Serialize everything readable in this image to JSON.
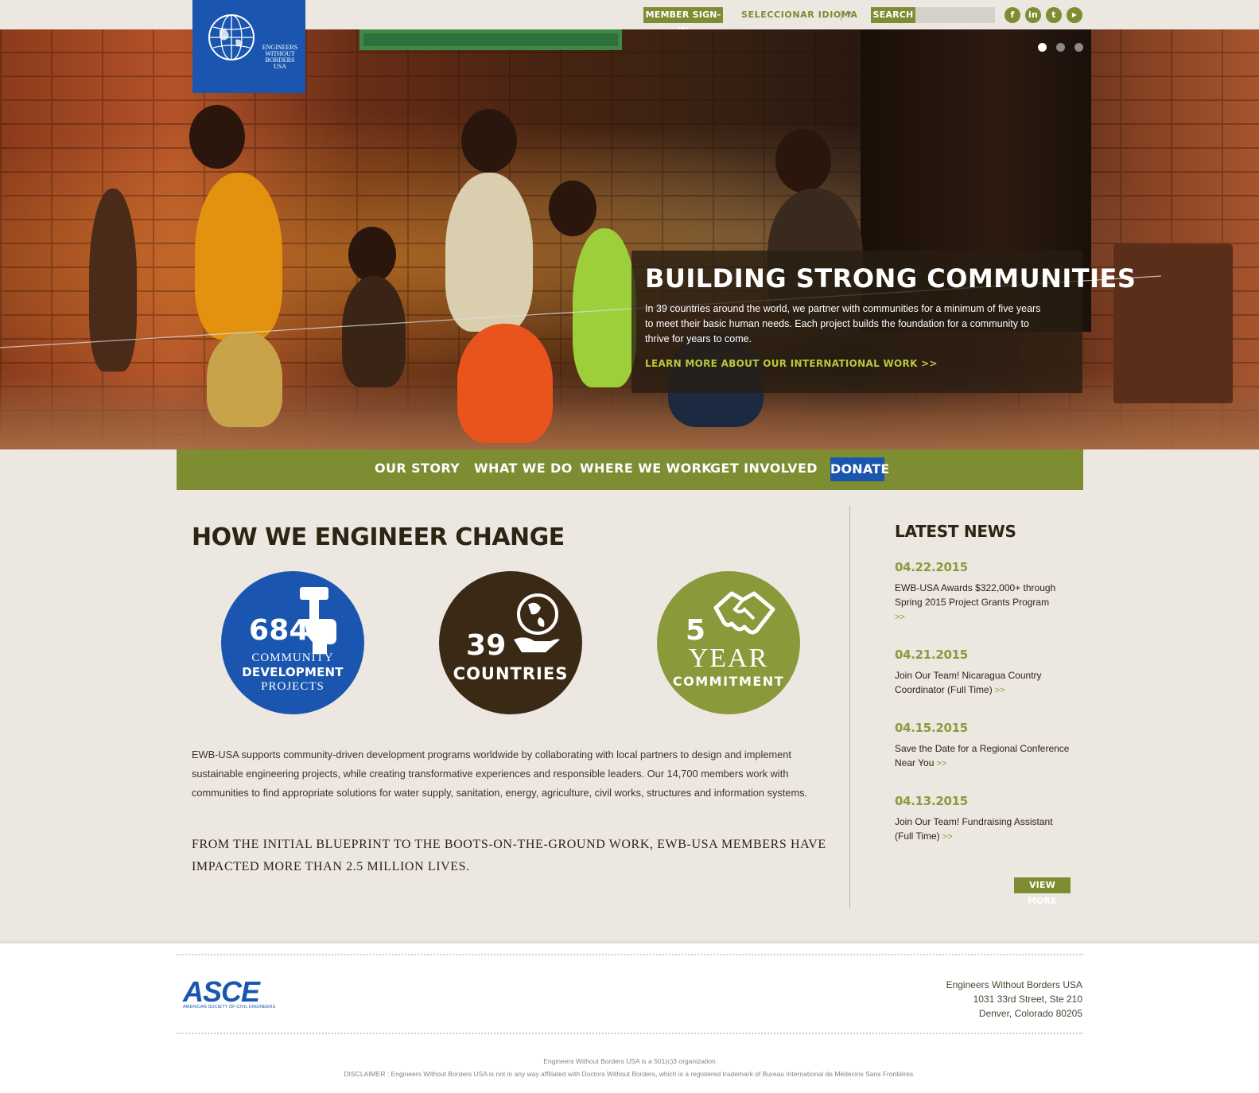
{
  "header": {
    "logo_text": "ENGINEERS\nWITHOUT\nBORDERS\nUSA",
    "member_signin": "MEMBER SIGN-IN",
    "language": "SELECCIONAR IDIOMA",
    "language_arrow": "▼",
    "search_label": "SEARCH",
    "search_value": "",
    "social": [
      {
        "icon": "facebook-icon",
        "glyph": "f"
      },
      {
        "icon": "linkedin-icon",
        "glyph": "in"
      },
      {
        "icon": "twitter-icon",
        "glyph": "t"
      },
      {
        "icon": "youtube-icon",
        "glyph": "▶"
      }
    ]
  },
  "hero": {
    "title": "BUILDING STRONG COMMUNITIES",
    "body": "In 39 countries around the world, we partner with communities for a minimum of five years to meet their basic human needs. Each project builds the foundation for a community to thrive for years to come.",
    "link": "LEARN MORE ABOUT OUR INTERNATIONAL WORK >>",
    "slides": 3,
    "active_slide": 1
  },
  "nav": {
    "items": [
      "OUR STORY",
      "WHAT WE DO",
      "WHERE WE WORK",
      "GET INVOLVED"
    ],
    "donate": "DONATE"
  },
  "main": {
    "title": "HOW WE ENGINEER CHANGE",
    "stats": [
      {
        "number": "684",
        "label_1": "COMMUNITY",
        "label_2": "DEVELOPMENT",
        "label_3": "PROJECTS",
        "color": "#1a56b0",
        "icon": "hammer-hand-icon"
      },
      {
        "number": "39",
        "label_1": "COUNTRIES",
        "color": "#3a2a15",
        "icon": "globe-hand-icon"
      },
      {
        "number": "5",
        "label_1": "YEAR",
        "label_2": "COMMITMENT",
        "color": "#8a9a3a",
        "icon": "handshake-icon"
      }
    ],
    "body": "EWB-USA supports community-driven development programs worldwide by collaborating with local partners to design and implement sustainable engineering projects, while creating transformative experiences and responsible leaders. Our 14,700 members work with communities to find appropriate solutions for water supply, sanitation, energy, agriculture, civil works, structures and information systems.",
    "impact": "FROM THE INITIAL BLUEPRINT TO THE BOOTS-ON-THE-GROUND WORK, EWB-USA MEMBERS HAVE IMPACTED MORE THAN 2.5 MILLION LIVES."
  },
  "news": {
    "title": "LATEST NEWS",
    "more_marker": ">>",
    "items": [
      {
        "date": "04.22.2015",
        "text": "EWB-USA Awards $322,000+ through Spring 2015 Project Grants Program"
      },
      {
        "date": "04.21.2015",
        "text": "Join Our Team! Nicaragua Country Coordinator (Full Time)"
      },
      {
        "date": "04.15.2015",
        "text": "Save the Date for a Regional Conference Near You"
      },
      {
        "date": "04.13.2015",
        "text": "Join Our Team! Fundraising Assistant (Full Time)"
      }
    ],
    "view_more": "VIEW MORE"
  },
  "footer": {
    "asce_logo": "ASCE",
    "asce_sub": "AMERICAN SOCIETY OF CIVIL ENGINEERS",
    "org": "Engineers Without Borders USA",
    "street": "1031 33rd Street, Ste 210",
    "city": "Denver, Colorado 80205",
    "nonprofit": "Engineers Without Borders USA is a 501(c)3 organization",
    "disclaimer": "DISCLAIMER : Engineers Without Borders USA is not in any way affiliated with Doctors Without Borders, which is a registered trademark of Bureau International de Médecins Sans Frontières."
  },
  "colors": {
    "olive": "#7e8c32",
    "blue": "#1a56b0",
    "dark_brown": "#3a2a15",
    "background": "#ece7e0"
  }
}
